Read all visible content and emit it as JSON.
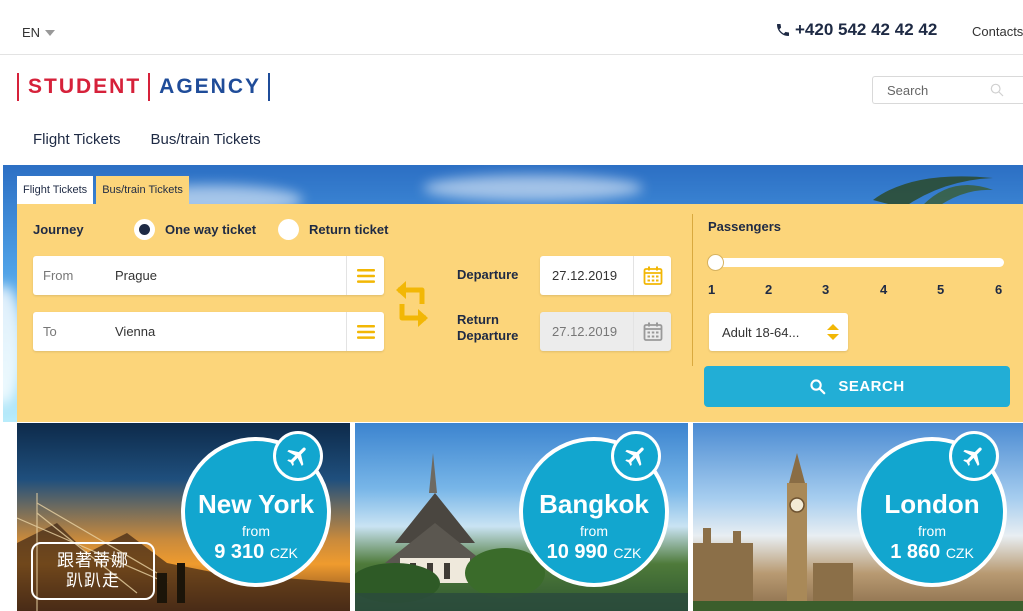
{
  "topbar": {
    "language": "EN",
    "phone": "+420 542 42 42 42",
    "contacts": "Contacts"
  },
  "brand": {
    "part1": "STUDENT",
    "part2": "AGENCY",
    "color_red": "#d6213a",
    "color_blue": "#1f4c99"
  },
  "search": {
    "placeholder": "Search"
  },
  "nav": {
    "items": [
      "Flight Tickets",
      "Bus/train Tickets"
    ]
  },
  "form": {
    "tabs": [
      {
        "label": "Flight Tickets",
        "active": false
      },
      {
        "label": "Bus/train Tickets",
        "active": true
      }
    ],
    "journey_label": "Journey",
    "trip_options": [
      {
        "label": "One way ticket",
        "selected": true
      },
      {
        "label": "Return ticket",
        "selected": false
      }
    ],
    "from": {
      "label": "From",
      "value": "Prague"
    },
    "to": {
      "label": "To",
      "value": "Vienna"
    },
    "departure_label": "Departure",
    "departure_date": "27.12.2019",
    "return_label_line1": "Return",
    "return_label_line2": "Departure",
    "return_date": "27.12.2019",
    "passengers_label": "Passengers",
    "passenger_ticks": [
      "1",
      "2",
      "3",
      "4",
      "5",
      "6"
    ],
    "passenger_count": 1,
    "passenger_type": "Adult 18-64...",
    "search_button": "SEARCH",
    "panel_color": "#fcd57a",
    "button_color": "#22aed6"
  },
  "destinations": [
    {
      "city": "New York",
      "from": "from",
      "price": "9 310",
      "currency": "CZK"
    },
    {
      "city": "Bangkok",
      "from": "from",
      "price": "10 990",
      "currency": "CZK"
    },
    {
      "city": "London",
      "from": "from",
      "price": "1 860",
      "currency": "CZK"
    }
  ],
  "watermark": {
    "line1": "跟著蒂娜",
    "line2": "趴趴走"
  }
}
